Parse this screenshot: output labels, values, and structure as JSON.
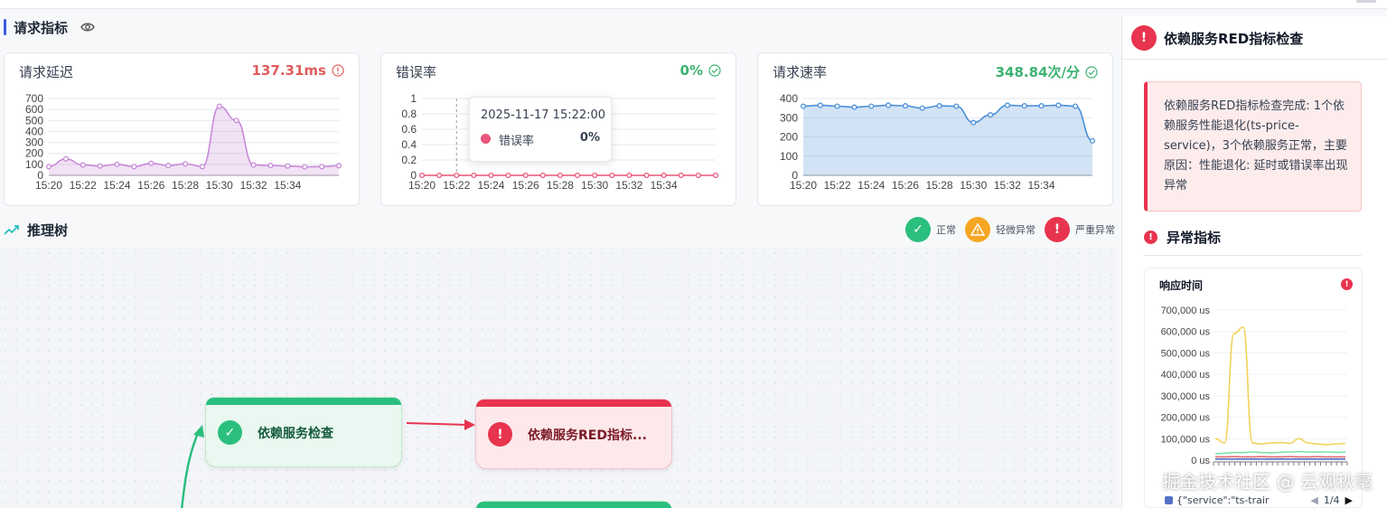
{
  "header": {
    "section_title": "请求指标"
  },
  "cards": [
    {
      "title": "请求延迟",
      "value": "137.31ms",
      "status": "error",
      "color": "#e05c5c"
    },
    {
      "title": "错误率",
      "value": "0%",
      "status": "ok",
      "color": "#3cb371"
    },
    {
      "title": "请求速率",
      "value": "348.84次/分",
      "status": "ok",
      "color": "#3cb371"
    }
  ],
  "chart_data": [
    {
      "type": "area",
      "title": "请求延迟",
      "x": [
        "15:20",
        "15:21",
        "15:22",
        "15:23",
        "15:24",
        "15:25",
        "15:26",
        "15:27",
        "15:28",
        "15:29",
        "15:30",
        "15:31",
        "15:32",
        "15:33",
        "15:34",
        "15:35",
        "15:36",
        "15:37"
      ],
      "xticks": [
        "15:20",
        "15:22",
        "15:24",
        "15:26",
        "15:28",
        "15:30",
        "15:32",
        "15:34"
      ],
      "values": [
        80,
        150,
        95,
        85,
        100,
        80,
        110,
        90,
        105,
        80,
        630,
        500,
        95,
        90,
        85,
        78,
        80,
        88
      ],
      "ylim": [
        0,
        700
      ],
      "yticks": [
        0,
        100,
        200,
        300,
        400,
        500,
        600,
        700
      ],
      "color": "#c78ad8",
      "grid": true
    },
    {
      "type": "line",
      "title": "错误率",
      "x": [
        "15:20",
        "15:21",
        "15:22",
        "15:23",
        "15:24",
        "15:25",
        "15:26",
        "15:27",
        "15:28",
        "15:29",
        "15:30",
        "15:31",
        "15:32",
        "15:33",
        "15:34",
        "15:35",
        "15:36",
        "15:37"
      ],
      "xticks": [
        "15:20",
        "15:22",
        "15:24",
        "15:26",
        "15:28",
        "15:30",
        "15:32",
        "15:34"
      ],
      "values": [
        0,
        0,
        0,
        0,
        0,
        0,
        0,
        0,
        0,
        0,
        0,
        0,
        0,
        0,
        0,
        0,
        0,
        0
      ],
      "ylim": [
        0,
        1
      ],
      "yticks": [
        0,
        0.2,
        0.4,
        0.6,
        0.8,
        1
      ],
      "color": "#e8547a",
      "grid": true,
      "tooltip": {
        "time": "2025-11-17 15:22:00",
        "series": "错误率",
        "value": "0%"
      }
    },
    {
      "type": "area",
      "title": "请求速率",
      "x": [
        "15:20",
        "15:21",
        "15:22",
        "15:23",
        "15:24",
        "15:25",
        "15:26",
        "15:27",
        "15:28",
        "15:29",
        "15:30",
        "15:31",
        "15:32",
        "15:33",
        "15:34",
        "15:35",
        "15:36",
        "15:37"
      ],
      "xticks": [
        "15:20",
        "15:22",
        "15:24",
        "15:26",
        "15:28",
        "15:30",
        "15:32",
        "15:34"
      ],
      "values": [
        360,
        365,
        360,
        355,
        360,
        365,
        362,
        350,
        362,
        360,
        275,
        315,
        365,
        362,
        362,
        365,
        360,
        180
      ],
      "ylim": [
        0,
        400
      ],
      "yticks": [
        0,
        100,
        200,
        300,
        400
      ],
      "color": "#4a90d9",
      "grid": true
    },
    {
      "type": "line",
      "title": "响应时间",
      "yticks": [
        "0 us",
        "100,000 us",
        "200,000 us",
        "300,000 us",
        "400,000 us",
        "500,000 us",
        "600,000 us",
        "700,000 us"
      ],
      "ylim": [
        0,
        700000
      ],
      "series": [
        {
          "values": [
            100000,
            80000,
            590000,
            620000,
            80000,
            75000,
            80000,
            82000,
            78000,
            100000,
            80000,
            75000,
            72000,
            75000,
            78000
          ],
          "color": "#f2d35b"
        },
        {
          "values": [
            30000,
            32000,
            35000,
            35000,
            38000,
            35000,
            34000,
            36000,
            38000,
            40000,
            38000,
            37000,
            38000,
            36000,
            37000
          ],
          "color": "#7fe0a8"
        },
        {
          "values": [
            15000,
            15000,
            16000,
            15000,
            15000,
            16000,
            15000,
            15000,
            16000,
            15000,
            15000,
            16000,
            15000,
            15000,
            15000
          ],
          "color": "#e86b6b"
        },
        {
          "values": [
            5000,
            5000,
            5000,
            5000,
            5000,
            5000,
            5000,
            5000,
            5000,
            5000,
            5000,
            5000,
            5000,
            5000,
            5000
          ],
          "color": "#5470c6"
        }
      ],
      "legend": "{\"service\":\"ts-trair",
      "pager": "1/4"
    }
  ],
  "tree": {
    "title": "推理树",
    "legend": [
      {
        "label": "正常",
        "icon": "check-icon",
        "color": "#2bbf7e"
      },
      {
        "label": "轻微异常",
        "icon": "warning-icon",
        "color": "#f5a623"
      },
      {
        "label": "严重异常",
        "icon": "exclaim-icon",
        "color": "#e8344e"
      }
    ],
    "nodes": [
      {
        "label": "依赖服务检查",
        "status": "normal"
      },
      {
        "label": "依赖服务RED指标...",
        "status": "severe"
      }
    ]
  },
  "panel": {
    "title": "依赖服务RED指标检查",
    "summary": "依赖服务RED指标检查完成: 1个依赖服务性能退化(ts-price-service)，3个依赖服务正常，主要原因：性能退化: 延时或错误率出现异常",
    "anomaly_title": "异常指标",
    "metric_title": "响应时间"
  },
  "watermark": "掘金技术社区 @ 云观秋毫"
}
